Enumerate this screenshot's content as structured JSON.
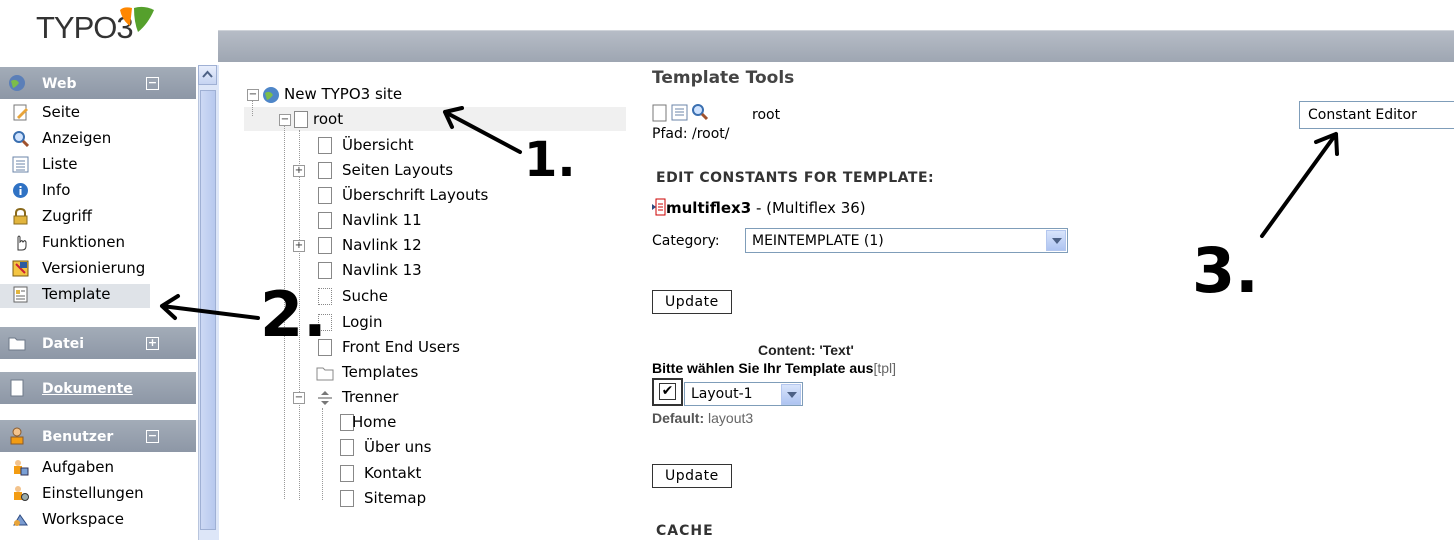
{
  "brand": {
    "logo_text": "TYPO3",
    "accent": "#ff8700"
  },
  "sidebar": {
    "groups": [
      {
        "label": "Web",
        "toggle": "−"
      },
      {
        "label": "Datei",
        "toggle": "+"
      },
      {
        "label": "Dokumente"
      },
      {
        "label": "Benutzer",
        "toggle": "−"
      }
    ],
    "web_items": [
      {
        "label": "Seite",
        "icon": "page-edit-icon"
      },
      {
        "label": "Anzeigen",
        "icon": "magnifier-icon"
      },
      {
        "label": "Liste",
        "icon": "list-icon"
      },
      {
        "label": "Info",
        "icon": "info-icon"
      },
      {
        "label": "Zugriff",
        "icon": "lock-icon"
      },
      {
        "label": "Funktionen",
        "icon": "hand-icon"
      },
      {
        "label": "Versionierung",
        "icon": "versioning-icon"
      },
      {
        "label": "Template",
        "icon": "template-icon"
      }
    ],
    "user_items": [
      {
        "label": "Aufgaben",
        "icon": "tasks-icon"
      },
      {
        "label": "Einstellungen",
        "icon": "settings-icon"
      },
      {
        "label": "Workspace",
        "icon": "workspace-icon"
      }
    ]
  },
  "tree": {
    "site": "New TYPO3 site",
    "root": "root",
    "children": [
      "Übersicht",
      "Seiten Layouts",
      "Überschrift Layouts",
      "Navlink 11",
      "Navlink 12",
      "Navlink 13",
      "Suche",
      "Login",
      "Front End Users",
      "Templates",
      "Trenner"
    ],
    "trenner_children": [
      "Home",
      "Über uns",
      "Kontakt",
      "Sitemap"
    ]
  },
  "module": {
    "title": "Template Tools",
    "page": "root",
    "path": "Pfad: /root/",
    "section_title": "EDIT CONSTANTS FOR TEMPLATE:",
    "template_name": "multiflex3",
    "template_suffix": " - (Multiflex 36)",
    "category_label": "Category:",
    "category_value": "MEINTEMPLATE (1)",
    "update_label": "Update",
    "content_heading": "Content: 'Text'",
    "choose_label": "Bitte wählen Sie Ihr Template aus",
    "choose_tag": "[tpl]",
    "checkbox_mark": "✔",
    "layout_value": "Layout-1",
    "default_label": "Default:",
    "default_value": "layout3",
    "cache_title": "CACHE",
    "function_menu": "Constant Editor"
  },
  "annotations": [
    "1.",
    "2.",
    "3."
  ]
}
